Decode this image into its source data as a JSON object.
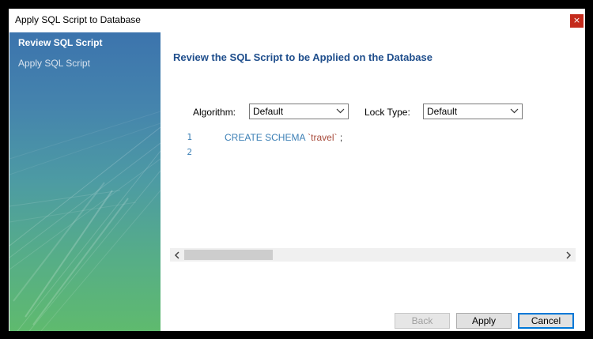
{
  "window": {
    "title": "Apply SQL Script to Database",
    "close_label": "×"
  },
  "sidebar": {
    "steps": [
      {
        "label": "Review SQL Script",
        "active": true
      },
      {
        "label": "Apply SQL Script",
        "active": false
      }
    ]
  },
  "main": {
    "heading": "Review the SQL Script to be Applied on the Database",
    "algorithm": {
      "label": "Algorithm:",
      "value": "Default"
    },
    "lock_type": {
      "label": "Lock Type:",
      "value": "Default"
    },
    "editor": {
      "lines": [
        {
          "number": "1",
          "keyword": "CREATE SCHEMA",
          "identifier": "`travel`",
          "punct": ";"
        },
        {
          "number": "2",
          "keyword": "",
          "identifier": "",
          "punct": ""
        }
      ]
    }
  },
  "buttons": {
    "back": "Back",
    "apply": "Apply",
    "cancel": "Cancel"
  },
  "colors": {
    "close_button": "#c42b1c",
    "heading": "#1f4e8c",
    "keyword": "#3b7fb5",
    "identifier": "#a84a3a",
    "sidebar_top": "#3c74ad",
    "sidebar_bottom": "#5fba6e",
    "default_button_border": "#0078d7"
  },
  "icons": {
    "close": "close-icon",
    "combo_arrow": "chevron-down-icon",
    "scroll_left": "chevron-left-icon",
    "scroll_right": "chevron-right-icon"
  }
}
